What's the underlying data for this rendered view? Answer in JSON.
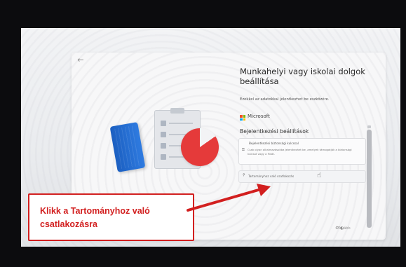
{
  "window": {
    "back_glyph": "←",
    "title": "Munkahelyi vagy iskolai dolgok beállítása",
    "subtitle": "Ezekkel az adatokkal jelentkezhet be eszközére.",
    "provider": "Microsoft",
    "section_heading": "Bejelentkezési beállítások",
    "info_card": {
      "title": "Bejelentkezési biztonsági kulcssal",
      "body": "Csak olyan alkalmazásokba jelentkezhet be, amelyek támogatják a biztonsági kulcsot vagy a Fidót."
    },
    "domain_join_label": "Tartományhoz való csatlakozás",
    "next_label": "Tovább"
  },
  "annotation": {
    "text": "Klikk a Tartományhoz való csatlakozásra",
    "color": "#d21f1f"
  },
  "colors": {
    "accent": "#2f7be0",
    "ms_red": "#f25022",
    "ms_green": "#7fba00",
    "ms_blue": "#00a4ef",
    "ms_yellow": "#ffb900"
  }
}
